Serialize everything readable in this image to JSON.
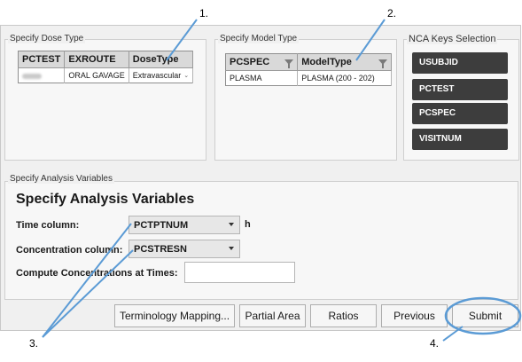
{
  "callouts": [
    "1.",
    "2.",
    "3.",
    "4."
  ],
  "dose_type": {
    "label": "Specify Dose Type",
    "headers": [
      "PCTEST",
      "EXROUTE",
      "DoseType"
    ],
    "row": {
      "exroute": "ORAL GAVAGE",
      "dosetype": "Extravascular"
    }
  },
  "model_type": {
    "label": "Specify Model Type",
    "headers": [
      "PCSPEC",
      "ModelType"
    ],
    "row": {
      "pcspec": "PLASMA",
      "modeltype": "PLASMA (200 - 202)"
    }
  },
  "nca_keys": {
    "label": "NCA Keys Selection",
    "keys": [
      "USUBJID",
      "PCTEST",
      "PCSPEC",
      "VISITNUM"
    ]
  },
  "analysis": {
    "group_label": "Specify Analysis Variables",
    "title": "Specify Analysis Variables",
    "time_label": "Time column:",
    "time_value": "PCTPTNUM",
    "time_unit": "h",
    "conc_label": "Concentration column:",
    "conc_value": "PCSTRESN",
    "compute_label": "Compute Concentrations at Times:",
    "compute_value": ""
  },
  "buttons": {
    "terminology": "Terminology Mapping...",
    "partial_area": "Partial Area",
    "ratios": "Ratios",
    "previous": "Previous",
    "submit": "Submit"
  },
  "colors": {
    "annotation_blue": "#5b9bd5",
    "key_button": "#3d3d3d"
  }
}
